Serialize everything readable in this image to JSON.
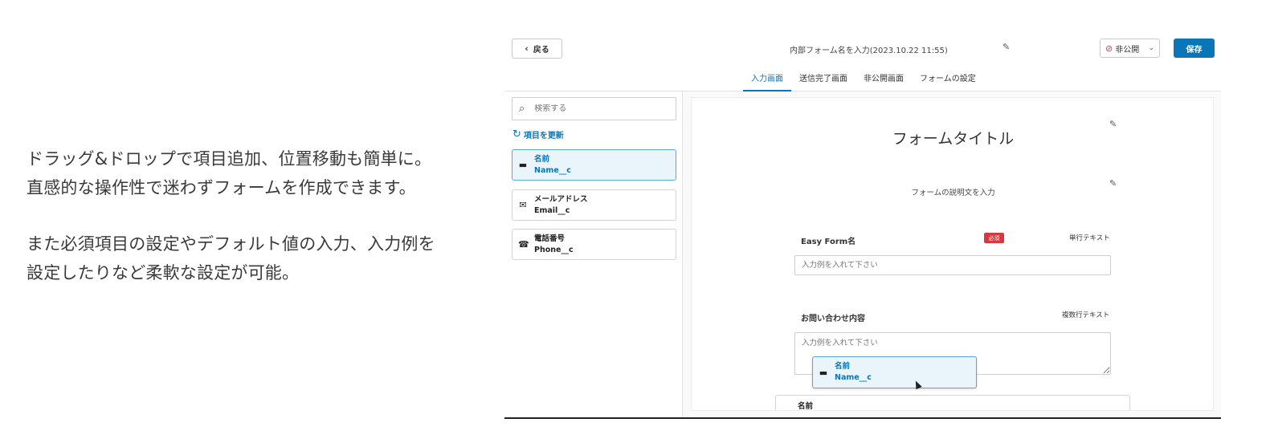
{
  "description": {
    "paragraph1": "ドラッグ&ドロップで項目追加、位置移動も簡単に。直感的な操作性で迷わずフォームを作成できます。",
    "paragraph2": "また必須項目の設定やデフォルト値の入力、入力例を設定したりなど柔軟な設定が可能。"
  },
  "header": {
    "back_label": "戻る",
    "form_name": "内部フォーム名を入力(2023.10.22 11:55)",
    "status_value": "非公開",
    "save_label": "保存"
  },
  "tabs": [
    {
      "label": "入力画面",
      "active": true
    },
    {
      "label": "送信完了画面",
      "active": false
    },
    {
      "label": "非公開画面",
      "active": false
    },
    {
      "label": "フォームの設定",
      "active": false
    }
  ],
  "sidebar": {
    "search_placeholder": "検索する",
    "refresh_label": "項目を更新",
    "items": [
      {
        "label": "名前",
        "api": "Name__c",
        "icon": "dash-icon",
        "selected": true
      },
      {
        "label": "メールアドレス",
        "api": "Email__c",
        "icon": "mail-icon",
        "selected": false
      },
      {
        "label": "電話番号",
        "api": "Phone__c",
        "icon": "phone-icon",
        "selected": false
      }
    ]
  },
  "canvas": {
    "form_title": "フォームタイトル",
    "form_description": "フォームの説明文を入力",
    "fields": [
      {
        "label": "Easy Form名",
        "required_badge": "必須",
        "type": "単行テキスト",
        "placeholder": "入力例を入れて下さい"
      },
      {
        "label": "お問い合わせ内容",
        "type": "複数行テキスト",
        "placeholder": "入力例を入れて下さい"
      }
    ],
    "drag_ghost": {
      "label": "名前",
      "api": "Name__c"
    },
    "dropped_item": {
      "label": "名前"
    }
  },
  "colors": {
    "accent": "#0a76b8",
    "required": "#d9363e",
    "selected_bg": "#eaf5fb"
  }
}
